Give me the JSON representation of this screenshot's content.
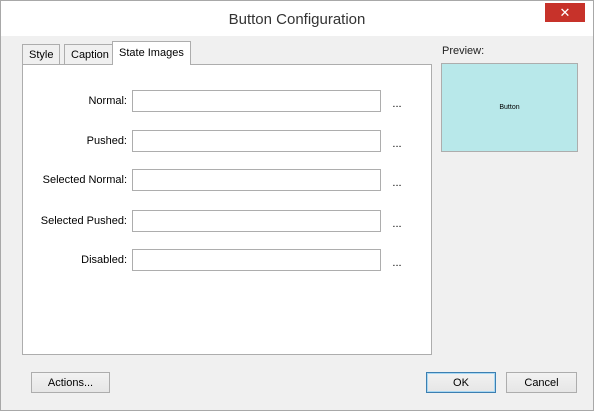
{
  "window": {
    "title": "Button Configuration",
    "close_glyph": "✕"
  },
  "tabs": [
    {
      "label": "Style",
      "active": false
    },
    {
      "label": "Caption",
      "active": false
    },
    {
      "label": "State Images",
      "active": true
    }
  ],
  "state_images": {
    "rows": [
      {
        "label": "Normal:",
        "value": "",
        "browse": "..."
      },
      {
        "label": "Pushed:",
        "value": "",
        "browse": "..."
      },
      {
        "label": "Selected Normal:",
        "value": "",
        "browse": "..."
      },
      {
        "label": "Selected Pushed:",
        "value": "",
        "browse": "..."
      },
      {
        "label": "Disabled:",
        "value": "",
        "browse": "..."
      }
    ]
  },
  "preview": {
    "label": "Preview:",
    "button_text": "Button",
    "background_color": "#b8e8ea"
  },
  "footer": {
    "actions_label": "Actions...",
    "ok_label": "OK",
    "cancel_label": "Cancel"
  }
}
